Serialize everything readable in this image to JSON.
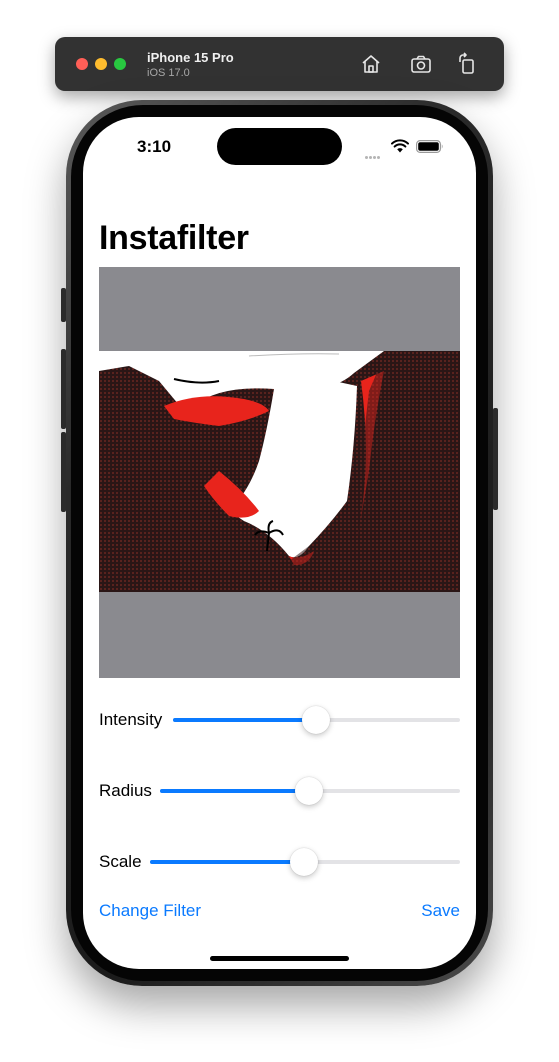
{
  "simulator": {
    "device_name": "iPhone 15 Pro",
    "os_version": "iOS 17.0",
    "toolbar_icons": [
      "home-icon",
      "screenshot-icon",
      "rotate-icon"
    ]
  },
  "status_bar": {
    "time": "3:10"
  },
  "app": {
    "title": "Instafilter",
    "sliders": [
      {
        "label": "Intensity",
        "value": 0.5
      },
      {
        "label": "Radius",
        "value": 0.5
      },
      {
        "label": "Scale",
        "value": 0.5
      }
    ],
    "change_filter_label": "Change Filter",
    "save_label": "Save"
  },
  "colors": {
    "accent": "#0A7AFF",
    "image_background": "#8A8A8F",
    "photo_highlight": "#E8241C"
  }
}
